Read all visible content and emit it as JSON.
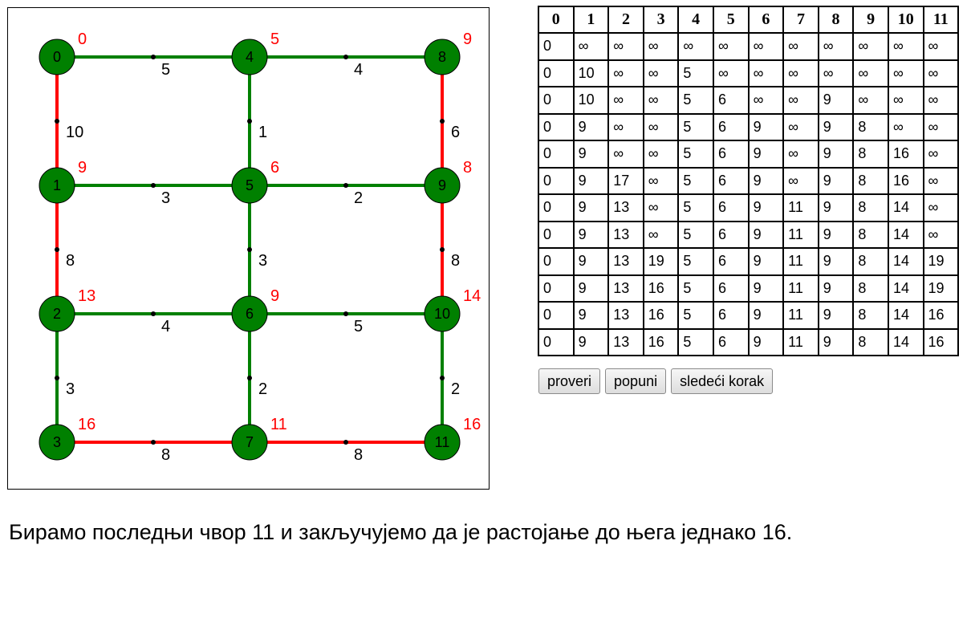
{
  "graph": {
    "colors": {
      "tree_edge": "#008000",
      "path_edge": "#ff0000",
      "node_fill": "#008000",
      "dist_label": "#ff0000"
    },
    "nodes": [
      {
        "id": "0",
        "dist": "0"
      },
      {
        "id": "1",
        "dist": "9"
      },
      {
        "id": "2",
        "dist": "13"
      },
      {
        "id": "3",
        "dist": "16"
      },
      {
        "id": "4",
        "dist": "5"
      },
      {
        "id": "5",
        "dist": "6"
      },
      {
        "id": "6",
        "dist": "9"
      },
      {
        "id": "7",
        "dist": "11"
      },
      {
        "id": "8",
        "dist": "9"
      },
      {
        "id": "9",
        "dist": "8"
      },
      {
        "id": "10",
        "dist": "14"
      },
      {
        "id": "11",
        "dist": "16"
      }
    ],
    "edges": [
      {
        "from": "0",
        "to": "4",
        "weight": "5",
        "color": "green"
      },
      {
        "from": "4",
        "to": "8",
        "weight": "4",
        "color": "green"
      },
      {
        "from": "1",
        "to": "5",
        "weight": "3",
        "color": "green"
      },
      {
        "from": "5",
        "to": "9",
        "weight": "2",
        "color": "green"
      },
      {
        "from": "2",
        "to": "6",
        "weight": "4",
        "color": "green"
      },
      {
        "from": "6",
        "to": "10",
        "weight": "5",
        "color": "green"
      },
      {
        "from": "3",
        "to": "7",
        "weight": "8",
        "color": "red"
      },
      {
        "from": "7",
        "to": "11",
        "weight": "8",
        "color": "red"
      },
      {
        "from": "0",
        "to": "1",
        "weight": "10",
        "color": "red"
      },
      {
        "from": "1",
        "to": "2",
        "weight": "8",
        "color": "red"
      },
      {
        "from": "2",
        "to": "3",
        "weight": "3",
        "color": "green"
      },
      {
        "from": "4",
        "to": "5",
        "weight": "1",
        "color": "green"
      },
      {
        "from": "5",
        "to": "6",
        "weight": "3",
        "color": "green"
      },
      {
        "from": "6",
        "to": "7",
        "weight": "2",
        "color": "green"
      },
      {
        "from": "8",
        "to": "9",
        "weight": "6",
        "color": "red"
      },
      {
        "from": "9",
        "to": "10",
        "weight": "8",
        "color": "red"
      },
      {
        "from": "10",
        "to": "11",
        "weight": "2",
        "color": "green"
      }
    ]
  },
  "table": {
    "headers": [
      "0",
      "1",
      "2",
      "3",
      "4",
      "5",
      "6",
      "7",
      "8",
      "9",
      "10",
      "11"
    ],
    "rows": [
      [
        "0",
        "∞",
        "∞",
        "∞",
        "∞",
        "∞",
        "∞",
        "∞",
        "∞",
        "∞",
        "∞",
        "∞"
      ],
      [
        "0",
        "10",
        "∞",
        "∞",
        "5",
        "∞",
        "∞",
        "∞",
        "∞",
        "∞",
        "∞",
        "∞"
      ],
      [
        "0",
        "10",
        "∞",
        "∞",
        "5",
        "6",
        "∞",
        "∞",
        "9",
        "∞",
        "∞",
        "∞"
      ],
      [
        "0",
        "9",
        "∞",
        "∞",
        "5",
        "6",
        "9",
        "∞",
        "9",
        "8",
        "∞",
        "∞"
      ],
      [
        "0",
        "9",
        "∞",
        "∞",
        "5",
        "6",
        "9",
        "∞",
        "9",
        "8",
        "16",
        "∞"
      ],
      [
        "0",
        "9",
        "17",
        "∞",
        "5",
        "6",
        "9",
        "∞",
        "9",
        "8",
        "16",
        "∞"
      ],
      [
        "0",
        "9",
        "13",
        "∞",
        "5",
        "6",
        "9",
        "11",
        "9",
        "8",
        "14",
        "∞"
      ],
      [
        "0",
        "9",
        "13",
        "∞",
        "5",
        "6",
        "9",
        "11",
        "9",
        "8",
        "14",
        "∞"
      ],
      [
        "0",
        "9",
        "13",
        "19",
        "5",
        "6",
        "9",
        "11",
        "9",
        "8",
        "14",
        "19"
      ],
      [
        "0",
        "9",
        "13",
        "16",
        "5",
        "6",
        "9",
        "11",
        "9",
        "8",
        "14",
        "19"
      ],
      [
        "0",
        "9",
        "13",
        "16",
        "5",
        "6",
        "9",
        "11",
        "9",
        "8",
        "14",
        "16"
      ],
      [
        "0",
        "9",
        "13",
        "16",
        "5",
        "6",
        "9",
        "11",
        "9",
        "8",
        "14",
        "16"
      ]
    ]
  },
  "buttons": {
    "check": "proveri",
    "fill": "popuni",
    "next": "sledeći korak"
  },
  "status": "Бирамо последњи чвор 11 и закључујемо да је растојање до њега једнако 16."
}
